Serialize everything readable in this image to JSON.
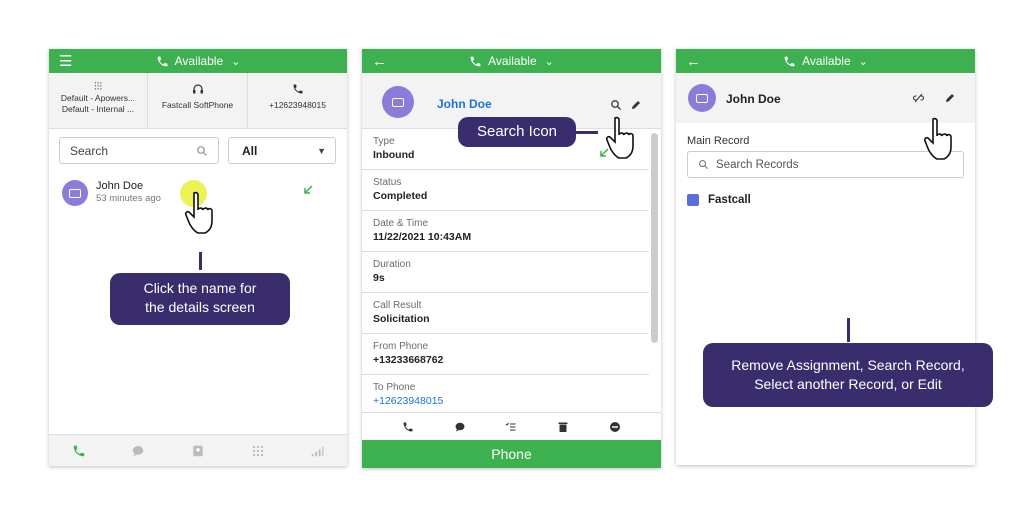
{
  "colors": {
    "green": "#3db050",
    "purple": "#3a2d6e",
    "avatar": "#8a7cd8",
    "link": "#1a73d9"
  },
  "status": "Available",
  "panel1": {
    "tools": [
      {
        "icon": "equalizer-icon",
        "lines": [
          "Default - Apowers...",
          "Default - Internal ..."
        ]
      },
      {
        "icon": "headset-icon",
        "lines": [
          "Fastcall SoftPhone"
        ]
      },
      {
        "icon": "phone-id-icon",
        "lines": [
          "+12623948015"
        ]
      }
    ],
    "search_placeholder": "Search",
    "filter": "All",
    "contact": {
      "name": "John Doe",
      "time": "53 minutes ago"
    },
    "callout": [
      "Click the name for",
      "the details screen"
    ],
    "nav": [
      "phone-icon",
      "chat-icon",
      "contacts-icon",
      "keypad-icon",
      "signal-icon"
    ]
  },
  "panel2": {
    "name": "John Doe",
    "callout": "Search Icon",
    "fields": [
      {
        "label": "Type",
        "value": "Inbound"
      },
      {
        "label": "Status",
        "value": "Completed"
      },
      {
        "label": "Date & Time",
        "value": "11/22/2021 10:43AM"
      },
      {
        "label": "Duration",
        "value": "9s"
      },
      {
        "label": "Call Result",
        "value": "Solicitation"
      },
      {
        "label": "From Phone",
        "value": "+13233668762"
      },
      {
        "label": "To Phone",
        "value": "+12623948015"
      }
    ],
    "actions": [
      "phone-icon",
      "chat-icon",
      "checklist-icon",
      "trash-icon",
      "minus-circle-icon"
    ],
    "footer": "Phone"
  },
  "panel3": {
    "name": "John Doe",
    "main_record": "Main Record",
    "search_placeholder": "Search Records",
    "record": "Fastcall",
    "callout": [
      "Remove Assignment, Search Record,",
      "Select another Record, or Edit"
    ]
  }
}
